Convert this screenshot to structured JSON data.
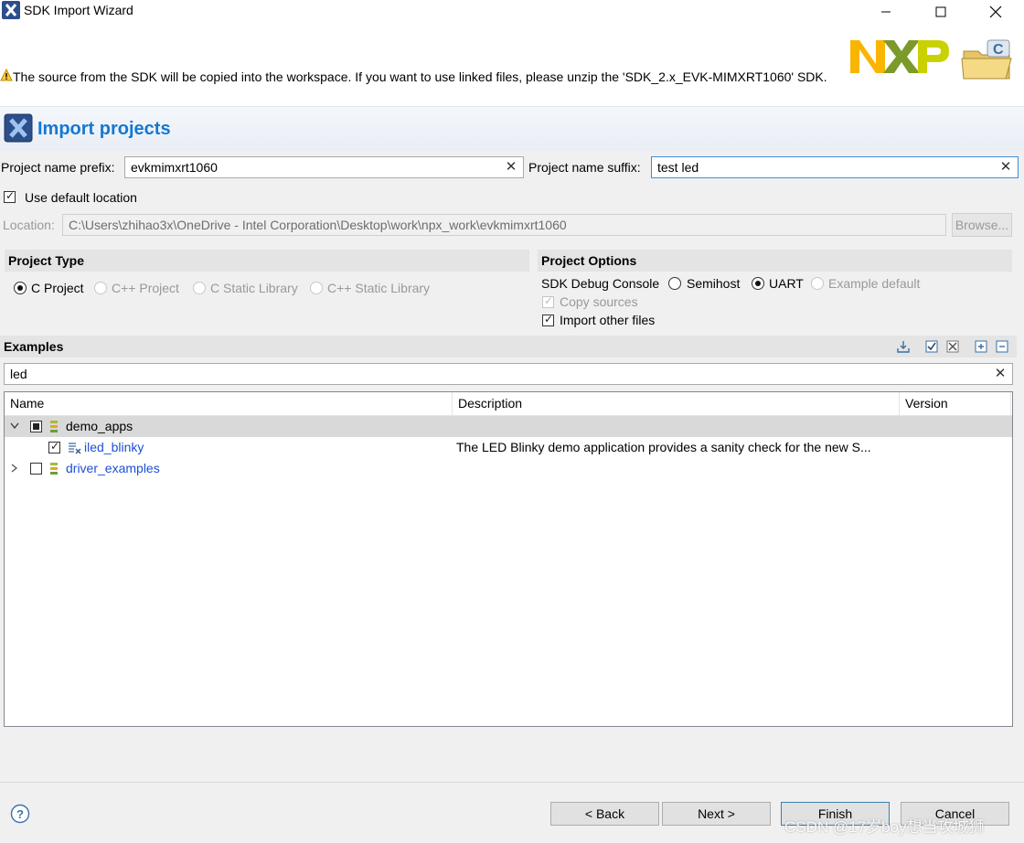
{
  "window": {
    "title": "SDK Import Wizard"
  },
  "banner": {
    "warning": "The source from the SDK will be copied into the workspace. If you want to use linked files, please unzip the 'SDK_2.x_EVK-MIMXRT1060' SDK.",
    "logo_text": "NXP"
  },
  "header": {
    "title": "Import projects"
  },
  "form": {
    "prefix_label": "Project name prefix:",
    "prefix_value": "evkmimxrt1060",
    "suffix_label": "Project name suffix:",
    "suffix_value": "test led",
    "use_default_location_label": "Use default location",
    "use_default_location_checked": true,
    "location_label": "Location:",
    "location_value": "C:\\Users\\zhihao3x\\OneDrive - Intel Corporation\\Desktop\\work\\npx_work\\evkmimxrt1060",
    "browse_label": "Browse..."
  },
  "project_type": {
    "heading": "Project Type",
    "options": [
      "C Project",
      "C++ Project",
      "C Static Library",
      "C++ Static Library"
    ],
    "selected": "C Project"
  },
  "project_options": {
    "heading": "Project Options",
    "debug_console_label": "SDK Debug Console",
    "debug_options": [
      "Semihost",
      "UART",
      "Example default"
    ],
    "debug_selected": "UART",
    "copy_sources_label": "Copy sources",
    "import_other_files_label": "Import other files"
  },
  "examples": {
    "heading": "Examples",
    "filter_value": "led",
    "columns": [
      "Name",
      "Description",
      "Version"
    ],
    "rows": [
      {
        "name": "demo_apps",
        "description": "",
        "version": ""
      },
      {
        "name": "iled_blinky",
        "description": "The LED Blinky demo application provides a sanity check for the new S...",
        "version": ""
      },
      {
        "name": "driver_examples",
        "description": "",
        "version": ""
      }
    ]
  },
  "buttons": {
    "back": "< Back",
    "next": "Next >",
    "finish": "Finish",
    "cancel": "Cancel"
  },
  "watermark": "CSDN @17岁boy想当攻城狮",
  "colors": {
    "accent_blue": "#1478d4",
    "link_blue": "#1c4fd6",
    "nxp_yellow": "#f9b500",
    "nxp_green": "#c9d200"
  }
}
